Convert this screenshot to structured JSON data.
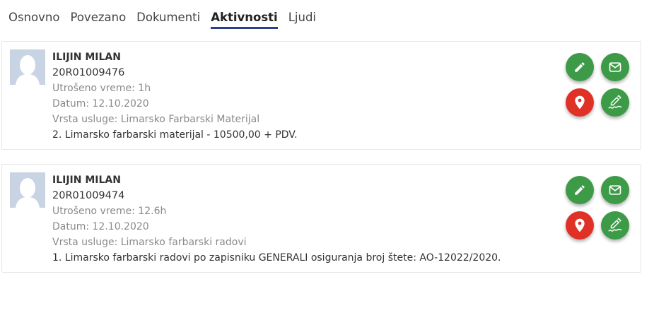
{
  "tabs": [
    {
      "label": "Osnovno"
    },
    {
      "label": "Povezano"
    },
    {
      "label": "Dokumenti"
    },
    {
      "label": "Aktivnosti"
    },
    {
      "label": "Ljudi"
    }
  ],
  "active_tab": "Aktivnosti",
  "activities": [
    {
      "name": "ILIJIN MILAN",
      "number": "20R01009476",
      "time_spent": "Utrošeno vreme: 1h",
      "date": "Datum: 12.10.2020",
      "service_type": "Vrsta usluge: Limarsko Farbarski Materijal",
      "description": "2. Limarsko farbarski materijal - 10500,00 + PDV."
    },
    {
      "name": "ILIJIN MILAN",
      "number": "20R01009474",
      "time_spent": "Utrošeno vreme: 12.6h",
      "date": "Datum: 12.10.2020",
      "service_type": "Vrsta usluge: Limarsko farbarski radovi",
      "description": "1. Limarsko farbarski radovi po zapisniku GENERALI osiguranja broj štete: AO-12022/2020."
    }
  ],
  "icons": {
    "edit": "pencil-icon",
    "mail": "envelope-icon",
    "location": "map-pin-icon",
    "sign": "signature-icon"
  },
  "colors": {
    "green": "#3d9a47",
    "red": "#e03127",
    "tab_underline": "#2c3e8f"
  }
}
